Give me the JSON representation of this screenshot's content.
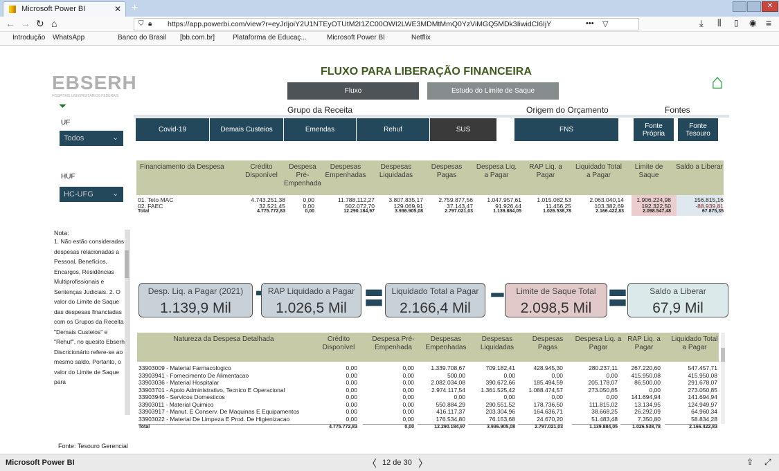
{
  "browser": {
    "tab_title": "Microsoft Power BI",
    "url": "https://app.powerbi.com/view?r=eyJrIjoiY2U1NTEyOTUtM2I1ZC00OWI2LWE3MDMtMmQ0YzViMGQ5MDk3IiwidCI6IjY",
    "bookmarks": [
      "Introdução",
      "WhatsApp",
      "Banco do Brasil",
      "[bb.com.br]",
      "Plataforma de Educaç...",
      "Microsoft Power BI",
      "Netflix"
    ]
  },
  "report": {
    "logo": "EBSERH",
    "logo_sub": "HOSPITAIS UNIVERSITÁRIOS FEDERAIS",
    "title": "FLUXO PARA LIBERAÇÃO FINANCEIRA",
    "nav_fluxo": "Fluxo",
    "nav_estudo": "Estudo do Limite de Saque",
    "group_receita": "Grupo da Receita",
    "group_origem": "Origem do Orçamento",
    "group_fontes": "Fontes",
    "receita_buttons": [
      "Covid-19",
      "Demais Custeios",
      "Emendas",
      "Rehuf",
      "SUS"
    ],
    "origem_button": "FNS",
    "fonte_propria": "Fonte Própria",
    "fonte_tesouro": "Fonte Tesouro",
    "uf_label": "UF",
    "uf_value": "Todos",
    "huf_label": "HUF",
    "huf_value": "HC-UFG",
    "note_title": "Nota:",
    "note_text": "1. Não estão consideradas despesas relacionadas a Pessoal, Benefícios, Encargos, Residências Multiprofissionais e Sentenças Judiciais. 2. O valor do Limite de Saque das despesas financiadas com os Grupos da Receita \"Demais Custeios\" e \"Rehuf\", no quesito Ebserh Discricionário refere-se ao mesmo saldo. Portanto, o valor do Limite de Saque para",
    "fonte_footer": "Fonte: Tesouro Gerencial"
  },
  "table1": {
    "headers": [
      "Financiamento da Despesa",
      "Crédito Disponível",
      "Despesa Pré-Empenhada",
      "Despesas Empenhadas",
      "Despesas Liquidadas",
      "Despesas Pagas",
      "Despesa Liq. a Pagar",
      "RAP Liq. a Pagar",
      "Liquidado Total a Pagar",
      "Limite de Saque",
      "Saldo a Liberar"
    ],
    "rows": [
      [
        "01. Teto MAC",
        "4.743.251,38",
        "0,00",
        "11.788.112,27",
        "3.807.835,17",
        "2.759.877,56",
        "1.047.957,61",
        "1.015.082,53",
        "2.063.040,14",
        "1.906.224,98",
        "156.815,16"
      ],
      [
        "02. FAEC",
        "32.521,45",
        "0,00",
        "502.072,70",
        "129.069,91",
        "37.143,47",
        "91.926,44",
        "11.456,25",
        "103.382,69",
        "192.322,50",
        "-88.939,81"
      ],
      [
        "Total",
        "4.775.772,83",
        "0,00",
        "12.290.184,97",
        "3.936.905,08",
        "2.797.021,03",
        "1.139.884,05",
        "1.026.538,78",
        "2.166.422,83",
        "2.098.547,48",
        "67.875,35"
      ]
    ]
  },
  "kpis": [
    {
      "label": "Desp. Liq. a Pagar (2021)",
      "value": "1.139,9 Mil",
      "color": "#c8d1d8"
    },
    {
      "label": "RAP Liquidado a Pagar",
      "value": "1.026,5 Mil",
      "color": "#c8d1d8"
    },
    {
      "label": "Liquidado Total a Pagar",
      "value": "2.166,4 Mil",
      "color": "#c8d1d8"
    },
    {
      "label": "Limite de Saque Total",
      "value": "2.098,5 Mil",
      "color": "#e2c9c9"
    },
    {
      "label": "Saldo a Liberar",
      "value": "67,9 Mil",
      "color": "#dce9ea"
    }
  ],
  "table2": {
    "headers": [
      "Natureza da Despesa Detalhada",
      "Crédito Disponível",
      "Despesa Pré-Empenhada",
      "Despesas Empenhadas",
      "Despesas Liquidadas",
      "Despesas Pagas",
      "Despesa Liq. a Pagar",
      "RAP Liq. a Pagar",
      "Liquidado Total a Pagar"
    ],
    "rows": [
      [
        "33903009 - Material Farmacologico",
        "0,00",
        "0,00",
        "1.339.708,67",
        "709.182,41",
        "428.945,30",
        "280.237,11",
        "267.220,60",
        "547.457,71"
      ],
      [
        "33903941 - Fornecimento De Alimentacao",
        "0,00",
        "0,00",
        "500,00",
        "0,00",
        "0,00",
        "0,00",
        "415.950,08",
        "415.950,08"
      ],
      [
        "33903036 - Material Hospitalar",
        "0,00",
        "0,00",
        "2.082.034,08",
        "390.672,66",
        "185.494,59",
        "205.178,07",
        "86.500,00",
        "291.678,07"
      ],
      [
        "33903701 - Apoio Administrativo, Tecnico E Operacional",
        "0,00",
        "0,00",
        "2.974.117,54",
        "1.361.525,42",
        "1.088.474,57",
        "273.050,85",
        "0,00",
        "273.050,85"
      ],
      [
        "33903946 - Servicos Domesticos",
        "0,00",
        "0,00",
        "0,00",
        "0,00",
        "0,00",
        "0,00",
        "141.694,94",
        "141.694,94"
      ],
      [
        "33903011 - Material Quimico",
        "0,00",
        "0,00",
        "550.884,29",
        "290.551,52",
        "178.736,50",
        "111.815,02",
        "13.134,95",
        "124.949,97"
      ],
      [
        "33903917 - Manut. E Conserv. De Maquinas E Equipamentos",
        "0,00",
        "0,00",
        "416.117,37",
        "203.304,96",
        "164.636,71",
        "38.668,25",
        "26.292,09",
        "64.960,34"
      ],
      [
        "33903022 - Material De Limpeza E Prod. De Higienizacao",
        "0,00",
        "0,00",
        "176.534,80",
        "76.153,68",
        "24.670,20",
        "51.483,48",
        "7.350,80",
        "58.834,28"
      ]
    ],
    "total": [
      "Total",
      "4.775.772,83",
      "0,00",
      "12.290.184,97",
      "3.936.905,08",
      "2.797.021,03",
      "1.139.884,05",
      "1.026.538,78",
      "2.166.422,83"
    ]
  },
  "status": {
    "app": "Microsoft Power BI",
    "page": "12 de 30"
  }
}
